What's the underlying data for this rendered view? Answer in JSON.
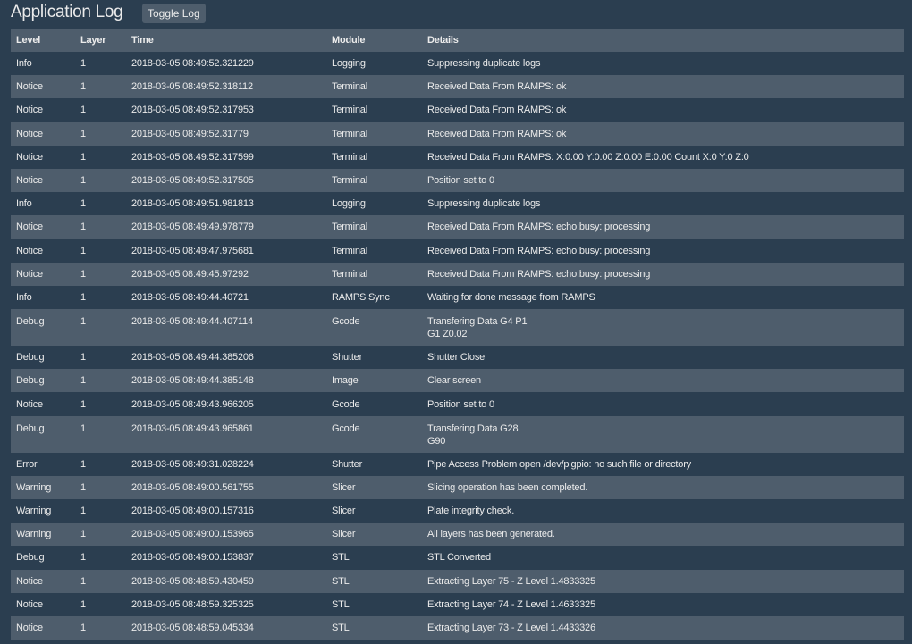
{
  "header": {
    "title": "Application Log",
    "toggle_label": "Toggle Log"
  },
  "table": {
    "columns": [
      "Level",
      "Layer",
      "Time",
      "Module",
      "Details"
    ],
    "rows": [
      {
        "level": "Info",
        "layer": "1",
        "time": "2018-03-05 08:49:52.321229",
        "module": "Logging",
        "details": [
          "Suppressing duplicate logs"
        ]
      },
      {
        "level": "Notice",
        "layer": "1",
        "time": "2018-03-05 08:49:52.318112",
        "module": "Terminal",
        "details": [
          "Received Data From RAMPS: ok"
        ]
      },
      {
        "level": "Notice",
        "layer": "1",
        "time": "2018-03-05 08:49:52.317953",
        "module": "Terminal",
        "details": [
          "Received Data From RAMPS: ok"
        ]
      },
      {
        "level": "Notice",
        "layer": "1",
        "time": "2018-03-05 08:49:52.31779",
        "module": "Terminal",
        "details": [
          "Received Data From RAMPS: ok"
        ]
      },
      {
        "level": "Notice",
        "layer": "1",
        "time": "2018-03-05 08:49:52.317599",
        "module": "Terminal",
        "details": [
          "Received Data From RAMPS: X:0.00 Y:0.00 Z:0.00 E:0.00 Count X:0 Y:0 Z:0"
        ]
      },
      {
        "level": "Notice",
        "layer": "1",
        "time": "2018-03-05 08:49:52.317505",
        "module": "Terminal",
        "details": [
          "Position set to 0"
        ]
      },
      {
        "level": "Info",
        "layer": "1",
        "time": "2018-03-05 08:49:51.981813",
        "module": "Logging",
        "details": [
          "Suppressing duplicate logs"
        ]
      },
      {
        "level": "Notice",
        "layer": "1",
        "time": "2018-03-05 08:49:49.978779",
        "module": "Terminal",
        "details": [
          "Received Data From RAMPS: echo:busy: processing"
        ]
      },
      {
        "level": "Notice",
        "layer": "1",
        "time": "2018-03-05 08:49:47.975681",
        "module": "Terminal",
        "details": [
          "Received Data From RAMPS: echo:busy: processing"
        ]
      },
      {
        "level": "Notice",
        "layer": "1",
        "time": "2018-03-05 08:49:45.97292",
        "module": "Terminal",
        "details": [
          "Received Data From RAMPS: echo:busy: processing"
        ]
      },
      {
        "level": "Info",
        "layer": "1",
        "time": "2018-03-05 08:49:44.40721",
        "module": "RAMPS Sync",
        "details": [
          "Waiting for done message from RAMPS"
        ]
      },
      {
        "level": "Debug",
        "layer": "1",
        "time": "2018-03-05 08:49:44.407114",
        "module": "Gcode",
        "details": [
          "Transfering Data G4 P1",
          "G1 Z0.02"
        ]
      },
      {
        "level": "Debug",
        "layer": "1",
        "time": "2018-03-05 08:49:44.385206",
        "module": "Shutter",
        "details": [
          "Shutter Close"
        ]
      },
      {
        "level": "Debug",
        "layer": "1",
        "time": "2018-03-05 08:49:44.385148",
        "module": "Image",
        "details": [
          "Clear screen"
        ]
      },
      {
        "level": "Notice",
        "layer": "1",
        "time": "2018-03-05 08:49:43.966205",
        "module": "Gcode",
        "details": [
          "Position set to 0"
        ]
      },
      {
        "level": "Debug",
        "layer": "1",
        "time": "2018-03-05 08:49:43.965861",
        "module": "Gcode",
        "details": [
          "Transfering Data G28",
          "G90"
        ]
      },
      {
        "level": "Error",
        "layer": "1",
        "time": "2018-03-05 08:49:31.028224",
        "module": "Shutter",
        "details": [
          "Pipe Access Problem open /dev/pigpio: no such file or directory"
        ]
      },
      {
        "level": "Warning",
        "layer": "1",
        "time": "2018-03-05 08:49:00.561755",
        "module": "Slicer",
        "details": [
          "Slicing operation has been completed."
        ]
      },
      {
        "level": "Warning",
        "layer": "1",
        "time": "2018-03-05 08:49:00.157316",
        "module": "Slicer",
        "details": [
          "Plate integrity check."
        ]
      },
      {
        "level": "Warning",
        "layer": "1",
        "time": "2018-03-05 08:49:00.153965",
        "module": "Slicer",
        "details": [
          "All layers has been generated."
        ]
      },
      {
        "level": "Debug",
        "layer": "1",
        "time": "2018-03-05 08:49:00.153837",
        "module": "STL",
        "details": [
          "STL Converted"
        ]
      },
      {
        "level": "Notice",
        "layer": "1",
        "time": "2018-03-05 08:48:59.430459",
        "module": "STL",
        "details": [
          "Extracting Layer 75 - Z Level 1.4833325"
        ]
      },
      {
        "level": "Notice",
        "layer": "1",
        "time": "2018-03-05 08:48:59.325325",
        "module": "STL",
        "details": [
          "Extracting Layer 74 - Z Level 1.4633325"
        ]
      },
      {
        "level": "Notice",
        "layer": "1",
        "time": "2018-03-05 08:48:59.045334",
        "module": "STL",
        "details": [
          "Extracting Layer 73 - Z Level 1.4433326"
        ]
      }
    ]
  }
}
